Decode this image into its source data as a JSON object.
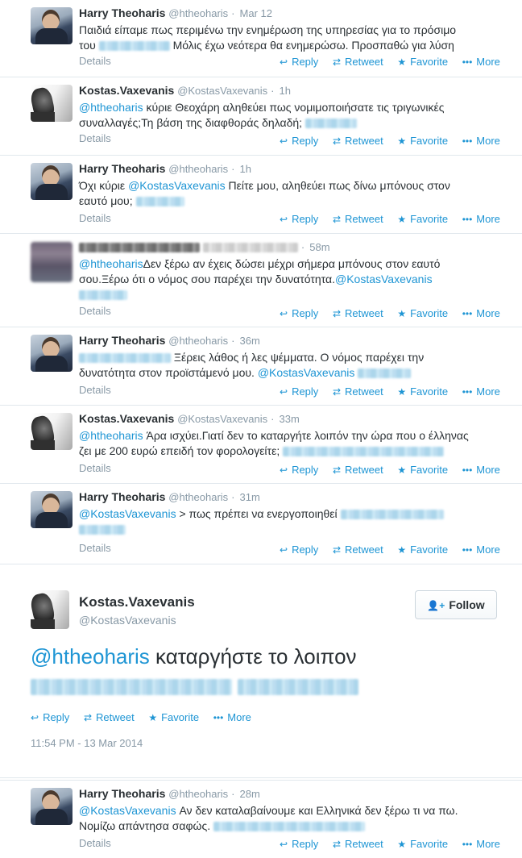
{
  "labels": {
    "details": "Details",
    "reply": "Reply",
    "retweet": "Retweet",
    "favorite": "Favorite",
    "more": "More",
    "follow": "Follow"
  },
  "icons": {
    "reply": "reply-arrow-icon",
    "retweet": "retweet-icon",
    "favorite": "star-icon",
    "more": "ellipsis-icon",
    "follow": "add-user-icon"
  },
  "colors": {
    "link": "#1e95d4",
    "muted": "#8899a6",
    "text": "#292f33"
  },
  "tweets": [
    {
      "name": "Harry Theoharis",
      "handle": "@htheoharis",
      "time": "Mar 12",
      "text1": "Παιδιά είπαμε πως περιμένω την ενημέρωση της υπηρεσίας για το πρόσιμο",
      "text2": "του",
      "text3": "Μόλις έχω νεότερα θα ενημερώσω. Προσπαθώ για λύση"
    },
    {
      "name": "Kostas.Vaxevanis",
      "handle": "@KostasVaxevanis",
      "time": "1h",
      "mention": "@htheoharis",
      "text1": " κύριε Θεοχάρη αληθεύει πως νομιμοποιήσατε τις τριγωνικές",
      "text2": "συναλλαγές;Τη βάση της διαφθοράς δηλαδή;"
    },
    {
      "name": "Harry Theoharis",
      "handle": "@htheoharis",
      "time": "1h",
      "text1": "Όχι κύριε ",
      "mention": "@KostasVaxevanis",
      "text2": " Πείτε μου, αληθεύει πως δίνω μπόνους στον",
      "text3": "εαυτό μου;"
    },
    {
      "time": "58m",
      "mention": "@htheoharis",
      "text1": "Δεν ξέρω αν έχεις δώσει μέχρι σήμερα μπόνους στον εαυτό",
      "text2": "σου.Ξέρω ότι ο νόμος σου παρέχει την δυνατότητα.",
      "mention2": "@KostasVaxevanis"
    },
    {
      "name": "Harry Theoharis",
      "handle": "@htheoharis",
      "time": "36m",
      "text1": " Ξέρεις λάθος ή λες ψέμματα. Ο νόμος παρέχει την",
      "text2": "δυνατότητα στον προϊστάμενό μου. ",
      "mention": "@KostasVaxevanis"
    },
    {
      "name": "Kostas.Vaxevanis",
      "handle": "@KostasVaxevanis",
      "time": "33m",
      "mention": "@htheoharis",
      "text1": " Άρα ισχύει.Γιατί δεν το καταργήτε λοιπόν την ώρα που ο έλληνας",
      "text2": "ζει με 200 ευρώ επειδή τον φορολογείτε;"
    },
    {
      "name": "Harry Theoharis",
      "handle": "@htheoharis",
      "time": "31m",
      "mention": "@KostasVaxevanis",
      "text1": " > πως πρέπει να ενεργοποιηθεί"
    },
    {
      "name": "Harry Theoharis",
      "handle": "@htheoharis",
      "time": "28m",
      "mention": "@KostasVaxevanis",
      "text1": " Αν δεν καταλαβαίνουμε και Ελληνικά δεν ξέρω τι να πω.",
      "text2": "Νομίζω απάντησα σαφώς."
    }
  ],
  "expanded": {
    "name": "Kostas.Vaxevanis",
    "handle": "@KostasVaxevanis",
    "mention": "@htheoharis",
    "text": " καταργήστε το λοιπον",
    "date": "11:54 PM - 13 Mar 2014"
  }
}
